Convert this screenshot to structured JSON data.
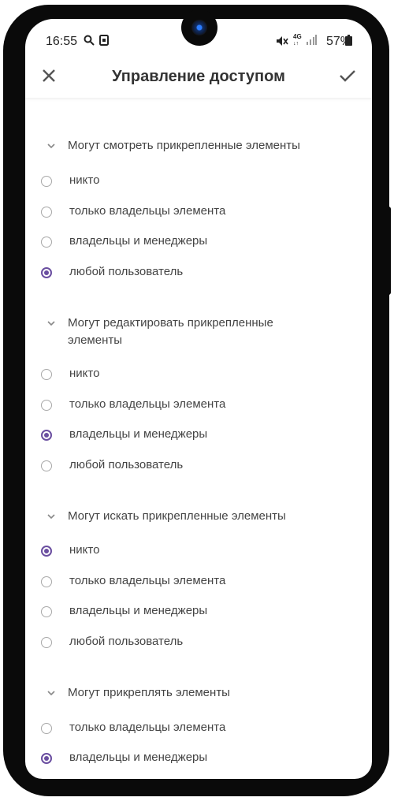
{
  "status_bar": {
    "time": "16:55",
    "icons": [
      "search-icon",
      "app-icon",
      "mute-icon",
      "4g-icon",
      "signal-icon",
      "battery-icon"
    ],
    "network": "4G",
    "battery": "57%"
  },
  "toolbar": {
    "title": "Управление доступом",
    "close_icon": "close-icon",
    "confirm_icon": "check-icon"
  },
  "accent_color": "#6a4ea0",
  "sections": [
    {
      "title": "Могут смотреть прикрепленные элементы",
      "options": [
        {
          "label": "никто",
          "selected": false
        },
        {
          "label": "только владельцы элемента",
          "selected": false
        },
        {
          "label": "владельцы и менеджеры",
          "selected": false
        },
        {
          "label": "любой пользователь",
          "selected": true
        }
      ]
    },
    {
      "title": "Могут редактировать прикрепленные элементы",
      "options": [
        {
          "label": "никто",
          "selected": false
        },
        {
          "label": "только владельцы элемента",
          "selected": false
        },
        {
          "label": "владельцы и менеджеры",
          "selected": true
        },
        {
          "label": "любой пользователь",
          "selected": false
        }
      ]
    },
    {
      "title": "Могут искать прикрепленные элементы",
      "options": [
        {
          "label": "никто",
          "selected": true
        },
        {
          "label": "только владельцы элемента",
          "selected": false
        },
        {
          "label": "владельцы и менеджеры",
          "selected": false
        },
        {
          "label": "любой пользователь",
          "selected": false
        }
      ]
    },
    {
      "title": "Могут прикреплять элементы",
      "options": [
        {
          "label": "только владельцы элемента",
          "selected": false
        },
        {
          "label": "владельцы и менеджеры",
          "selected": true
        }
      ]
    }
  ]
}
